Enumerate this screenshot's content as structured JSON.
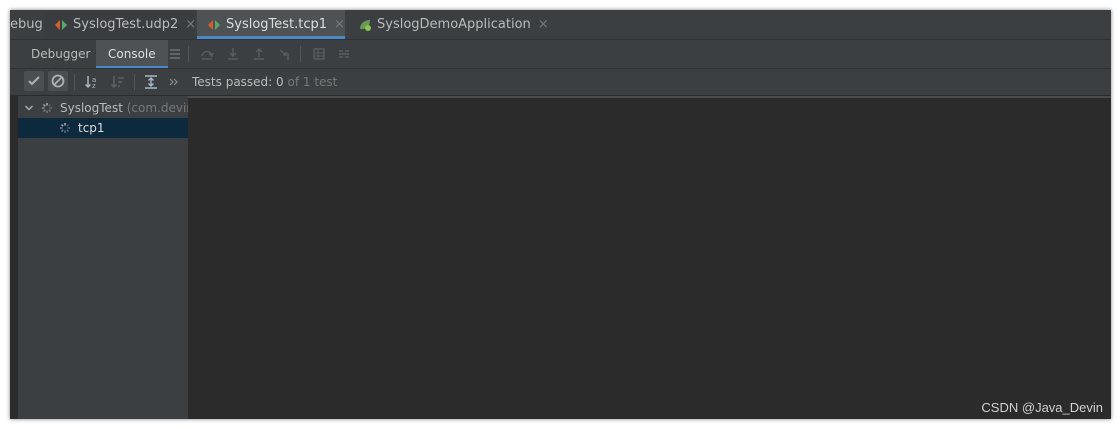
{
  "debug_label": "ebug:",
  "tabs": [
    {
      "label": "SyslogTest.udp2",
      "close": "×"
    },
    {
      "label": "SyslogTest.tcp1",
      "close": "×"
    },
    {
      "label": "SyslogDemoApplication",
      "close": "×"
    }
  ],
  "subtabs": {
    "debugger": "Debugger",
    "console": "Console"
  },
  "status": {
    "prefix": "Tests passed: ",
    "passed": "0",
    "suffix": " of 1 test"
  },
  "tree": [
    {
      "label": "SyslogTest",
      "detail": " (com.devin"
    },
    {
      "label": "tcp1"
    }
  ],
  "watermark": "CSDN @Java_Devin",
  "colors": {
    "accent": "#4a88c7",
    "selected_row": "#0d293e",
    "background": "#2b2b2b",
    "panel": "#3c3f41"
  }
}
